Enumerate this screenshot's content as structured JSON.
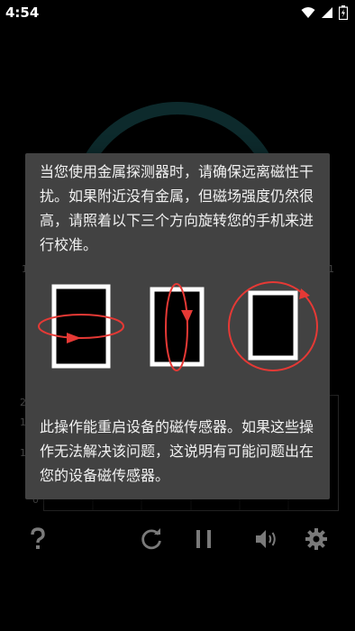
{
  "status_bar": {
    "time": "4:54",
    "icons": [
      "wifi-icon",
      "signal-icon",
      "battery-icon"
    ]
  },
  "background": {
    "chart_axis_labels": [
      "2",
      "1",
      "1",
      "0",
      "1",
      "1"
    ]
  },
  "dialog": {
    "intro_text": "当您使用金属探测器时，请确保远离磁性干扰。如果附近没有金属，但磁场强度仍然很高，请照着以下三个方向旋转您的手机来进行校准。",
    "outro_text": "此操作能重启设备的磁传感器。如果这些操作无法解决该问题，这说明有可能问题出在您的设备磁传感器。",
    "illustrations": [
      "rotate-horizontal-icon",
      "rotate-vertical-icon",
      "rotate-flat-icon"
    ]
  },
  "toolbar": {
    "buttons": [
      "help-icon",
      "refresh-icon",
      "pause-icon",
      "volume-icon",
      "settings-icon"
    ]
  },
  "colors": {
    "gauge": "#1a5558",
    "dialog": "#424242",
    "arrow": "#e53935"
  }
}
